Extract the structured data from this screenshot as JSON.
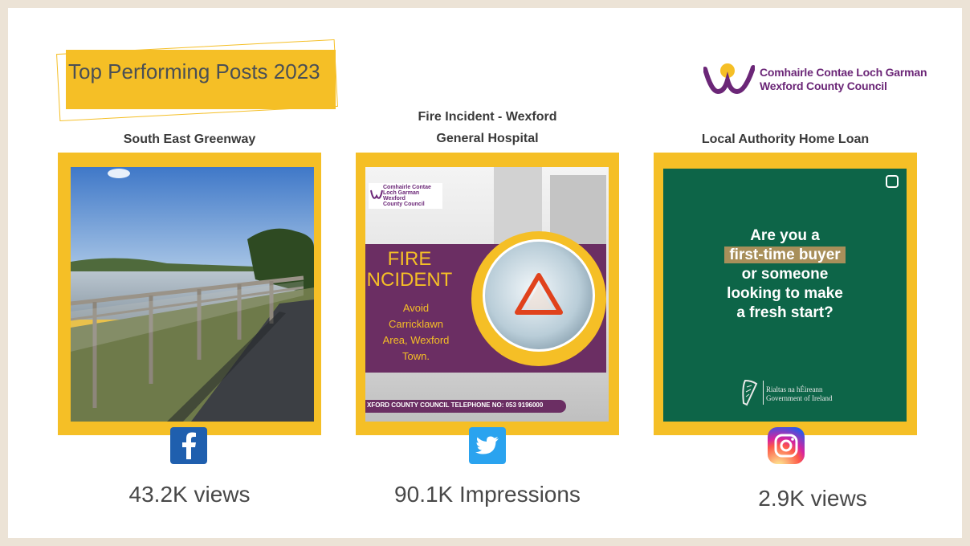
{
  "header": {
    "title": "Top Performing Posts 2023"
  },
  "council_logo": {
    "line1": "Comhairle Contae Loch Garman",
    "line2": "Wexford County Council"
  },
  "posts": [
    {
      "title": "South East Greenway",
      "platform_icon": "facebook-icon",
      "platform_color": "#1877f2",
      "metric": "43.2K views"
    },
    {
      "title_line1": "Fire Incident - Wexford",
      "title_line2": "General Hospital",
      "platform_icon": "twitter-icon",
      "platform_color": "#1da1f2",
      "metric": "90.1K Impressions",
      "image": {
        "logo_line1": "Comhairle Contae",
        "logo_line2": "Loch Garman",
        "logo_line3": "Wexford",
        "logo_line4": "County Council",
        "heading_line1": "FIRE",
        "heading_line2": "NCIDENT",
        "sub_line1": "Avoid",
        "sub_line2": "Carricklawn",
        "sub_line3": "Area, Wexford",
        "sub_line4": "Town.",
        "footer": "XFORD COUNTY COUNCIL TELEPHONE NO: 053 9196000"
      }
    },
    {
      "title": "Local Authority Home Loan",
      "platform_icon": "instagram-icon",
      "platform_color": "#d62976",
      "metric": "2.9K views",
      "image": {
        "line1": "Are you a",
        "highlight": "first-time buyer",
        "line3": "or someone",
        "line4": "looking to make",
        "line5": "a fresh start?",
        "gov_line1": "Rialtas na hÉireann",
        "gov_line2": "Government of Ireland"
      }
    }
  ],
  "colors": {
    "accent_yellow": "#f5bf26",
    "council_purple": "#6b2677",
    "loan_green": "#0d6548"
  }
}
